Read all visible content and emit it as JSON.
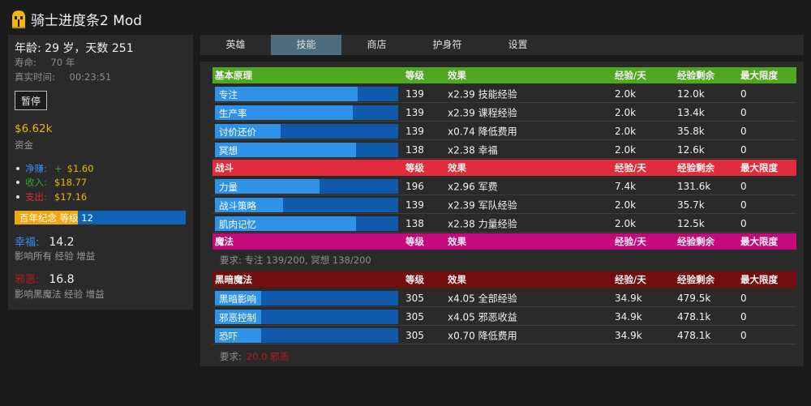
{
  "app": {
    "title": "骑士进度条2 Mod"
  },
  "stats": {
    "age_text": "年龄: 29 岁，天数 251",
    "lifespan_label": "寿命:",
    "lifespan_value": "70 年",
    "realtime_label": "真实时间:",
    "realtime_value": "00:23:51",
    "pause_label": "暂停",
    "money_value": "$6.62k",
    "money_label": "资金",
    "net_label": "净赚:",
    "net_sign": "+",
    "net_value": "$1.60",
    "income_label": "收入:",
    "income_value": "$18.77",
    "expense_label": "支出:",
    "expense_value": "$17.16",
    "centennial_text": "百年纪念 等级 12",
    "centennial_progress": 0.37,
    "happiness_label": "幸福:",
    "happiness_value": "14.2",
    "happiness_desc": "影响所有 经验 增益",
    "evil_label": "邪恶:",
    "evil_value": "16.8",
    "evil_desc": "影响黑魔法 经验 增益"
  },
  "tabs": [
    "英雄",
    "技能",
    "商店",
    "护身符",
    "设置"
  ],
  "active_tab": "技能",
  "colors": {
    "basics": "#4fa81e",
    "combat": "#e22c3c",
    "magic": "#c7077c",
    "dark_magic": "#760d0d",
    "bar_track": "#0f5aad",
    "bar_fill": "#2e93e8",
    "active_tab": "#4f6c7d"
  },
  "columns": {
    "level": "等级",
    "effect": "效果",
    "xp_per_day": "经验/天",
    "xp_left": "经验剩余",
    "max_level": "最大限度"
  },
  "categories": {
    "basics": {
      "name": "基本原理",
      "skills": [
        {
          "name": "专注",
          "progress": 0.78,
          "level": "139",
          "effect": "x2.39 技能经验",
          "xp_day": "2.0k",
          "xp_left": "12.0k",
          "max": "0"
        },
        {
          "name": "生产率",
          "progress": 0.75,
          "level": "139",
          "effect": "x2.39 课程经验",
          "xp_day": "2.0k",
          "xp_left": "13.4k",
          "max": "0"
        },
        {
          "name": "讨价还价",
          "progress": 0.36,
          "level": "139",
          "effect": "x0.74 降低费用",
          "xp_day": "2.0k",
          "xp_left": "35.8k",
          "max": "0"
        },
        {
          "name": "冥想",
          "progress": 0.77,
          "level": "138",
          "effect": "x2.38 幸福",
          "xp_day": "2.0k",
          "xp_left": "12.6k",
          "max": "0"
        }
      ]
    },
    "combat": {
      "name": "战斗",
      "skills": [
        {
          "name": "力量",
          "progress": 0.57,
          "level": "196",
          "effect": "x2.96 军费",
          "xp_day": "7.4k",
          "xp_left": "131.6k",
          "max": "0"
        },
        {
          "name": "战斗策略",
          "progress": 0.37,
          "level": "139",
          "effect": "x2.39 军队经验",
          "xp_day": "2.0k",
          "xp_left": "35.7k",
          "max": "0"
        },
        {
          "name": "肌肉记忆",
          "progress": 0.77,
          "level": "138",
          "effect": "x2.38 力量经验",
          "xp_day": "2.0k",
          "xp_left": "12.5k",
          "max": "0"
        }
      ]
    },
    "magic": {
      "name": "魔法",
      "requirement": "要求: 专注 139/200, 冥想 138/200"
    },
    "dark_magic": {
      "name": "黑暗魔法",
      "skills": [
        {
          "name": "黑暗影响",
          "progress": 0.25,
          "level": "305",
          "effect": "x4.05 全部经验",
          "xp_day": "34.9k",
          "xp_left": "479.5k",
          "max": "0"
        },
        {
          "name": "邪恶控制",
          "progress": 0.25,
          "level": "305",
          "effect": "x4.05 邪恶收益",
          "xp_day": "34.9k",
          "xp_left": "478.1k",
          "max": "0"
        },
        {
          "name": "恐吓",
          "progress": 0.25,
          "level": "305",
          "effect": "x0.70 降低费用",
          "xp_day": "34.9k",
          "xp_left": "478.1k",
          "max": "0"
        }
      ],
      "requirement_label": "要求:",
      "requirement_value": "20.0 邪恶"
    }
  }
}
